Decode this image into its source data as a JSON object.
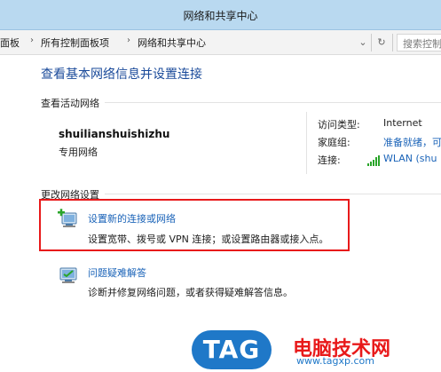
{
  "window": {
    "title": "网络和共享中心"
  },
  "breadcrumb": {
    "items": [
      "面板",
      "所有控制面板项",
      "网络和共享中心"
    ]
  },
  "search": {
    "placeholder": "搜索控制"
  },
  "main": {
    "heading": "查看基本网络信息并设置连接",
    "active_networks_label": "查看活动网络",
    "network": {
      "name": "shuilianshuishizhu",
      "type": "专用网络",
      "props": [
        {
          "label": "访问类型:",
          "value": "Internet",
          "link": false
        },
        {
          "label": "家庭组:",
          "value": "准备就绪，可",
          "link": true
        },
        {
          "label": "连接:",
          "value": "WLAN (shu",
          "link": true
        }
      ]
    },
    "change_settings_label": "更改网络设置",
    "tasks": [
      {
        "title": "设置新的连接或网络",
        "desc": "设置宽带、拨号或 VPN 连接；或设置路由器或接入点。",
        "icon": "network-setup-icon"
      },
      {
        "title": "问题疑难解答",
        "desc": "诊断并修复网络问题，或者获得疑难解答信息。",
        "icon": "troubleshoot-icon"
      }
    ]
  },
  "watermark": {
    "badge": "TAG",
    "site_name": "电脑技术网",
    "url": "www.tagxp.com"
  },
  "colors": {
    "titlebar": "#b9d9f0",
    "link": "#1a63b8",
    "heading": "#1a4a9a",
    "highlight": "#e8191a",
    "badge_bg": "#1f78c8",
    "site_red": "#e8191a"
  }
}
